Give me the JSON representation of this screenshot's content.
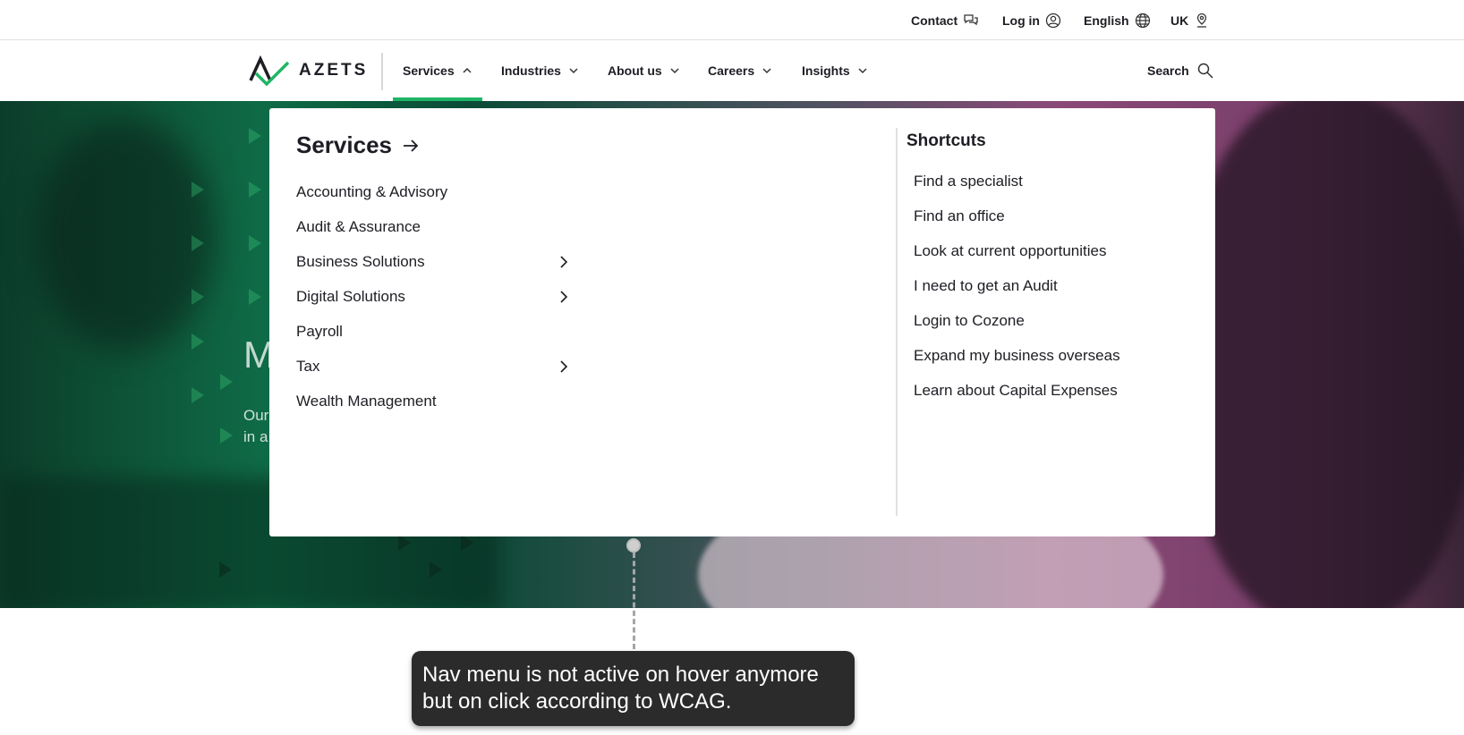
{
  "utility": {
    "contact": "Contact",
    "login": "Log in",
    "language": "English",
    "region": "UK"
  },
  "logo": {
    "text": "AZETS",
    "color": "#20b566"
  },
  "nav": {
    "items": [
      {
        "label": "Services",
        "active": true
      },
      {
        "label": "Industries"
      },
      {
        "label": "About us"
      },
      {
        "label": "Careers"
      },
      {
        "label": "Insights"
      }
    ],
    "search": "Search",
    "active_color": "#20b566"
  },
  "hero": {
    "title_fragment": "M",
    "text_line1": "Our",
    "text_line2": "in a"
  },
  "dropdown": {
    "title": "Services",
    "items": [
      {
        "label": "Accounting & Advisory",
        "has_submenu": false
      },
      {
        "label": "Audit & Assurance",
        "has_submenu": false
      },
      {
        "label": "Business Solutions",
        "has_submenu": true
      },
      {
        "label": "Digital Solutions",
        "has_submenu": true
      },
      {
        "label": "Payroll",
        "has_submenu": false
      },
      {
        "label": "Tax",
        "has_submenu": true
      },
      {
        "label": "Wealth Management",
        "has_submenu": false
      }
    ],
    "shortcuts_title": "Shortcuts",
    "shortcuts": [
      "Find a specialist",
      "Find an office",
      "Look at current opportunities",
      "I need to get an Audit",
      "Login to Cozone",
      "Expand my business overseas",
      "Learn about Capital Expenses"
    ]
  },
  "annotation": {
    "line1": "Nav menu is not active on hover anymore",
    "line2": "but on click according to WCAG."
  }
}
